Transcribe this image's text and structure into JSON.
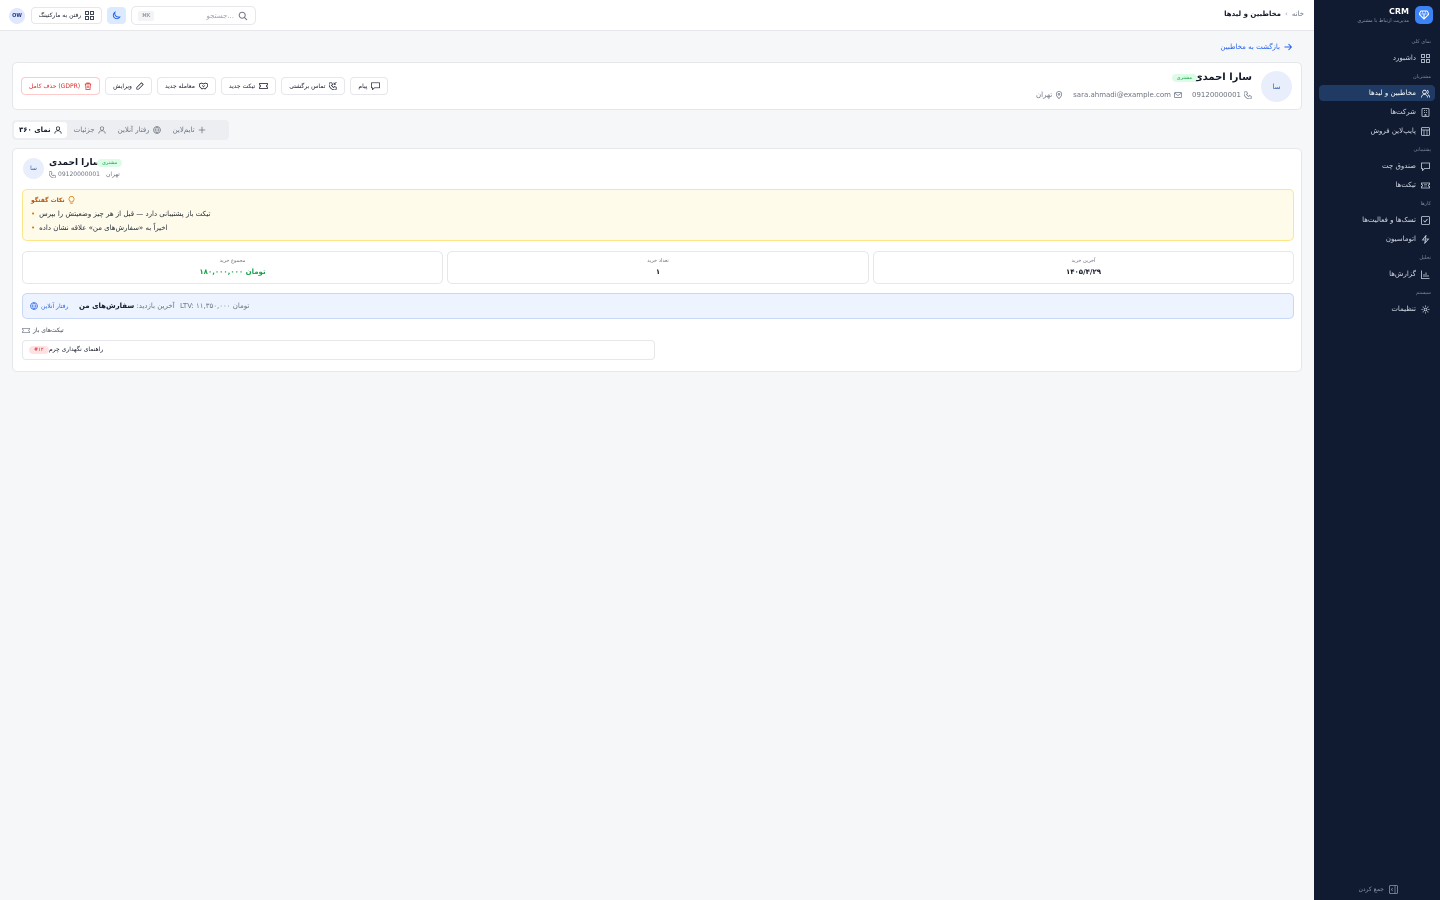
{
  "brand": {
    "name": "CRM",
    "subtitle": "مدیریت ارتباط با مشتری"
  },
  "sidebar": {
    "sections": [
      {
        "label": "نمای کلی"
      },
      {
        "label": "مشتریان"
      },
      {
        "label": "پشتیبانی"
      },
      {
        "label": "کارها"
      },
      {
        "label": "تحلیل"
      },
      {
        "label": "سیستم"
      }
    ],
    "items": [
      {
        "label": "داشبورد",
        "icon": "grid-icon"
      },
      {
        "label": "مخاطبین و لیدها",
        "icon": "users-icon",
        "active": true
      },
      {
        "label": "شرکت‌ها",
        "icon": "building-icon"
      },
      {
        "label": "پایپ‌لاین فروش",
        "icon": "pipeline-icon"
      },
      {
        "label": "صندوق چت",
        "icon": "chat-icon"
      },
      {
        "label": "تیکت‌ها",
        "icon": "ticket-icon"
      },
      {
        "label": "تسک‌ها و فعالیت‌ها",
        "icon": "checkbox-icon"
      },
      {
        "label": "اتوماسیون",
        "icon": "zap-icon"
      },
      {
        "label": "گزارش‌ها",
        "icon": "chart-icon"
      },
      {
        "label": "تنظیمات",
        "icon": "gear-icon"
      }
    ],
    "collapse_label": "جمع کردن"
  },
  "topbar": {
    "breadcrumb_home": "خانه",
    "breadcrumb_current": "مخاطبین و لیدها",
    "search_placeholder": "جستجو...",
    "search_kbd": "⌘K",
    "marketing_label": "رفتن به مارکتینگ",
    "avatar_initials": "OW"
  },
  "back_label": "بازگشت به مخاطبین",
  "contact": {
    "avatar": "سا",
    "name": "سارا احمدی",
    "status": "مشتری",
    "phone": "09120000001",
    "email": "sara.ahmadi@example.com",
    "city": "تهران"
  },
  "actions": {
    "message": "پیام",
    "callback": "تماس برگشتی",
    "new_ticket": "تیکت جدید",
    "new_deal": "معامله جدید",
    "edit": "ویرایش",
    "delete": "حذف کامل (GDPR)"
  },
  "tabs": [
    {
      "label": "تایم‌لاین"
    },
    {
      "label": "رفتار آنلاین"
    },
    {
      "label": "جزئیات"
    },
    {
      "label": "نمای ۳۶۰",
      "active": true
    }
  ],
  "view360": {
    "notes_title": "نکات گفتگو",
    "notes": [
      "تیکت باز پشتیبانی دارد — قبل از هر چیز وضعیتش را بپرس",
      "اخیراً به «سفارش‌های من» علاقه نشان داده"
    ],
    "stats": {
      "last_purchase_label": "آخرین خرید",
      "last_purchase_value": "۱۴۰۵/۴/۲۹",
      "purchase_count_label": "تعداد خرید",
      "purchase_count_value": "۱",
      "total_purchase_label": "مجموع خرید",
      "total_purchase_value": "۱۸۰,۰۰۰,۰۰۰ تومان"
    },
    "online_link": "رفتار آنلاین",
    "last_visit_label": "آخرین بازدید:",
    "last_visit_value": "سفارش‌های من",
    "ltv": "LTV: ۱۱,۳۵۰,۰۰۰ تومان",
    "open_tickets_label": "تیکت‌های باز",
    "ticket_number": "#۱۲",
    "ticket_title": "راهنمای نگهداری چرم"
  }
}
